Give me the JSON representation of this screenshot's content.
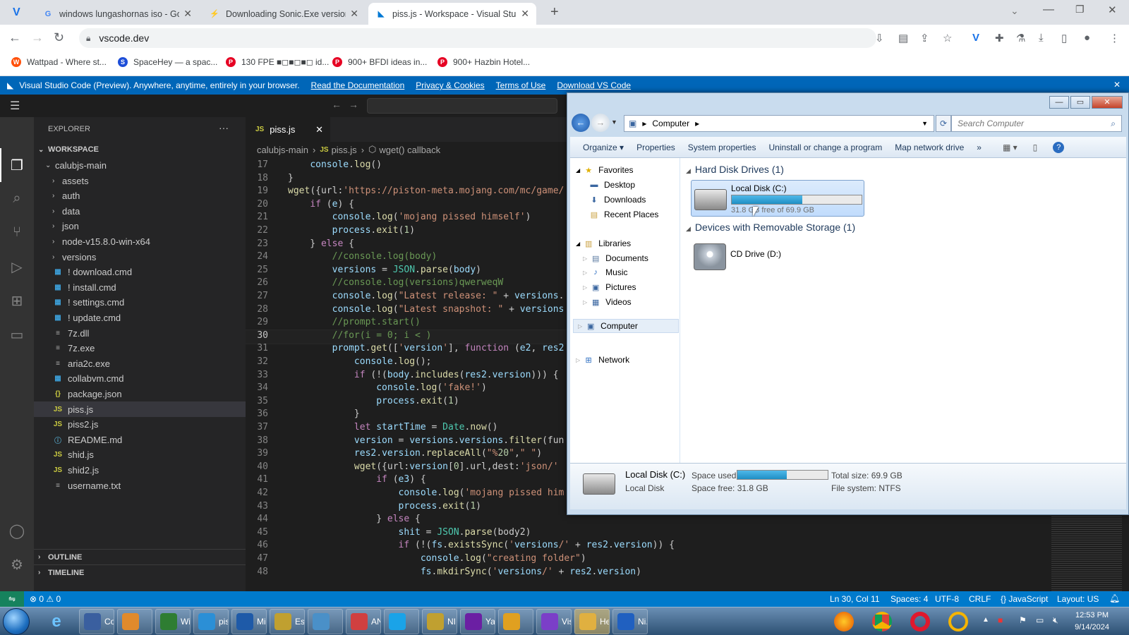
{
  "browser": {
    "tabs": [
      {
        "title": "windows lungashornas iso - Goo",
        "icon": "google-icon"
      },
      {
        "title": "Downloading Sonic.Exe version",
        "icon": "download-page-icon"
      },
      {
        "title": "piss.js - Workspace - Visual Stu",
        "icon": "vscode-icon"
      }
    ],
    "new_tab": "+",
    "url": "vscode.dev",
    "bookmarks": [
      {
        "label": "Wattpad - Where st...",
        "color": "#ff500a",
        "glyph": "W"
      },
      {
        "label": "SpaceHey — a spac...",
        "color": "#1d4ed8",
        "glyph": "S"
      },
      {
        "label": "130 FPE ■◻■◻■◻ id...",
        "color": "#e60023",
        "glyph": "P"
      },
      {
        "label": "900+ BFDI ideas in...",
        "color": "#e60023",
        "glyph": "P"
      },
      {
        "label": "900+ Hazbin Hotel...",
        "color": "#e60023",
        "glyph": "P"
      }
    ]
  },
  "banner": {
    "text": "Visual Studio Code (Preview). Anywhere, anytime, entirely in your browser.",
    "links": [
      "Read the Documentation",
      "Privacy & Cookies",
      "Terms of Use",
      "Download VS Code"
    ],
    "close": "✕"
  },
  "explorer": {
    "header": "EXPLORER",
    "more": "···",
    "workspace": "WORKSPACE",
    "root": "calubjs-main",
    "items": [
      {
        "label": "assets",
        "kind": "folder"
      },
      {
        "label": "auth",
        "kind": "folder"
      },
      {
        "label": "data",
        "kind": "folder"
      },
      {
        "label": "json",
        "kind": "folder"
      },
      {
        "label": "node-v15.8.0-win-x64",
        "kind": "folder"
      },
      {
        "label": "versions",
        "kind": "folder"
      },
      {
        "label": "! download.cmd",
        "kind": "cmd"
      },
      {
        "label": "! install.cmd",
        "kind": "cmd"
      },
      {
        "label": "! settings.cmd",
        "kind": "cmd"
      },
      {
        "label": "! update.cmd",
        "kind": "cmd"
      },
      {
        "label": "7z.dll",
        "kind": "txt"
      },
      {
        "label": "7z.exe",
        "kind": "txt"
      },
      {
        "label": "aria2c.exe",
        "kind": "txt"
      },
      {
        "label": "collabvm.cmd",
        "kind": "cmd"
      },
      {
        "label": "package.json",
        "kind": "json"
      },
      {
        "label": "piss.js",
        "kind": "js"
      },
      {
        "label": "piss2.js",
        "kind": "js"
      },
      {
        "label": "README.md",
        "kind": "md"
      },
      {
        "label": "shid.js",
        "kind": "js"
      },
      {
        "label": "shid2.js",
        "kind": "js"
      },
      {
        "label": "username.txt",
        "kind": "txt"
      }
    ],
    "outline": "OUTLINE",
    "timeline": "TIMELINE"
  },
  "editor": {
    "tab": "piss.js",
    "breadcrumb": [
      "calubjs-main",
      "piss.js",
      "wget() callback"
    ],
    "current_line": 30,
    "lines": [
      {
        "n": 17,
        "code": "    console.log()"
      },
      {
        "n": 18,
        "code": "}"
      },
      {
        "n": 19,
        "code": "wget({url:'https://piston-meta.mojang.com/mc/game/"
      },
      {
        "n": 20,
        "code": "    if (e) {"
      },
      {
        "n": 21,
        "code": "        console.log('mojang pissed himself')"
      },
      {
        "n": 22,
        "code": "        process.exit(1)"
      },
      {
        "n": 23,
        "code": "    } else {"
      },
      {
        "n": 24,
        "code": "        //console.log(body)"
      },
      {
        "n": 25,
        "code": "        versions = JSON.parse(body)"
      },
      {
        "n": 26,
        "code": "        //console.log(versions)qwerweqW"
      },
      {
        "n": 27,
        "code": "        console.log(\"Latest release: \" + versions."
      },
      {
        "n": 28,
        "code": "        console.log(\"Latest snapshot: \" + versions"
      },
      {
        "n": 29,
        "code": "        //prompt.start()"
      },
      {
        "n": 30,
        "code": "        //for(i = 0; i < )"
      },
      {
        "n": 31,
        "code": "        prompt.get(['version'], function (e2, res2"
      },
      {
        "n": 32,
        "code": "            console.log();"
      },
      {
        "n": 33,
        "code": "            if (!(body.includes(res2.version))) {"
      },
      {
        "n": 34,
        "code": "                console.log('fake!')"
      },
      {
        "n": 35,
        "code": "                process.exit(1)"
      },
      {
        "n": 36,
        "code": "            }"
      },
      {
        "n": 37,
        "code": "            let startTime = Date.now()"
      },
      {
        "n": 38,
        "code": "            version = versions.versions.filter(fun"
      },
      {
        "n": 39,
        "code": "            res2.version.replaceAll(\"%20\",\" \")"
      },
      {
        "n": 40,
        "code": "            wget({url:version[0].url,dest:'json/'"
      },
      {
        "n": 41,
        "code": "                if (e3) {"
      },
      {
        "n": 42,
        "code": "                    console.log('mojang pissed him"
      },
      {
        "n": 43,
        "code": "                    process.exit(1)"
      },
      {
        "n": 44,
        "code": "                } else {"
      },
      {
        "n": 45,
        "code": "                    shit = JSON.parse(body2)"
      },
      {
        "n": 46,
        "code": "                    if (!(fs.existsSync('versions/' + res2.version)) {"
      },
      {
        "n": 47,
        "code": "                        console.log(\"creating folder\")"
      },
      {
        "n": 48,
        "code": "                        fs.mkdirSync('versions/' + res2.version)"
      }
    ]
  },
  "status": {
    "problems": "⊗ 0 ⚠ 0",
    "position": "Ln 30, Col 11",
    "spaces": "Spaces: 4",
    "encoding": "UTF-8",
    "eol": "CRLF",
    "language": "{} JavaScript",
    "layout": "Layout: US"
  },
  "win_explorer": {
    "address": "Computer",
    "search_placeholder": "Search Computer",
    "commands": [
      "Organize ▾",
      "Properties",
      "System properties",
      "Uninstall or change a program",
      "Map network drive",
      "»"
    ],
    "nav": {
      "favorites": "Favorites",
      "fav_items": [
        "Desktop",
        "Downloads",
        "Recent Places"
      ],
      "libraries": "Libraries",
      "lib_items": [
        "Documents",
        "Music",
        "Pictures",
        "Videos"
      ],
      "computer": "Computer",
      "network": "Network"
    },
    "groups": {
      "hdd": "Hard Disk Drives (1)",
      "removable": "Devices with Removable Storage (1)"
    },
    "disk": {
      "name": "Local Disk (C:)",
      "free_text": "31.8 GB free of 69.9 GB",
      "used_fraction": 0.545
    },
    "cd": {
      "name": "CD Drive (D:)"
    },
    "details": {
      "name": "Local Disk (C:)",
      "type": "Local Disk",
      "space_used_label": "Space used:",
      "space_free": "Space free: 31.8 GB",
      "total_size": "Total size: 69.9 GB",
      "file_system": "File system: NTFS"
    }
  },
  "taskbar": {
    "items": [
      {
        "label": "Co...",
        "color": "#3a5f9f"
      },
      {
        "label": "",
        "color": "#e08a2c"
      },
      {
        "label": "Wi...",
        "color": "#2e7d32"
      },
      {
        "label": "pis...",
        "color": "#2b8fd6"
      },
      {
        "label": "Mi...",
        "color": "#1e5aa8"
      },
      {
        "label": "Esc...",
        "color": "#c0a030"
      },
      {
        "label": "",
        "color": "#4a90c8"
      },
      {
        "label": "AN...",
        "color": "#d04040"
      },
      {
        "label": "",
        "color": "#1aa3e8"
      },
      {
        "label": "NI...",
        "color": "#c0a030"
      },
      {
        "label": "Ya...",
        "color": "#6b1fa3"
      },
      {
        "label": "",
        "color": "#e0a020"
      },
      {
        "label": "Vis...",
        "color": "#7b3fc8"
      },
      {
        "label": "He...",
        "color": "#e0b040"
      },
      {
        "label": "Ni...",
        "color": "#2060c0"
      }
    ],
    "time": "12:53 PM",
    "date": "9/14/2024"
  }
}
